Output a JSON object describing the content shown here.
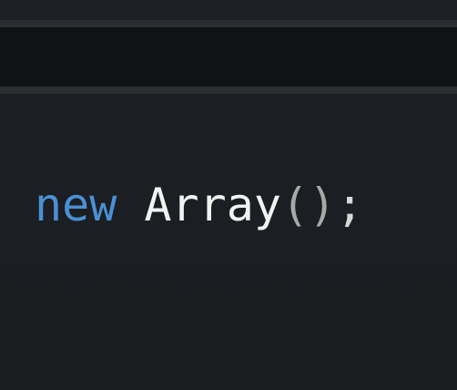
{
  "editor": {
    "code": {
      "keyword": "new",
      "space": " ",
      "identifier": "Array",
      "parens": "()",
      "semicolon": ";"
    }
  },
  "colors": {
    "keyword": "#4b8fd4",
    "identifier": "#f2f2f2",
    "punctuation": "#a8a8a8",
    "background": "#1c1f23",
    "toolbar": "#111213",
    "border": "#2b2e31"
  }
}
